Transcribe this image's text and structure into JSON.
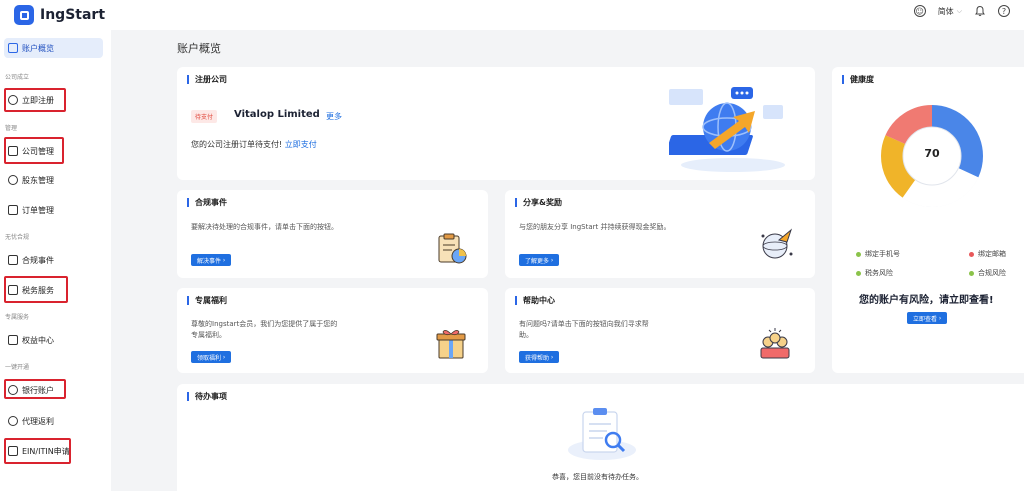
{
  "brand": {
    "name": "IngStart"
  },
  "topbar": {
    "lang": "简体"
  },
  "sidebar": {
    "items": [
      {
        "label": "账户概览"
      },
      {
        "label": "立即注册"
      },
      {
        "label": "公司管理"
      },
      {
        "label": "股东管理"
      },
      {
        "label": "订单管理"
      },
      {
        "label": "合规事件"
      },
      {
        "label": "税务服务"
      },
      {
        "label": "权益中心"
      },
      {
        "label": "银行账户"
      },
      {
        "label": "代理返利"
      },
      {
        "label": "EIN/ITIN申请"
      }
    ],
    "sections": [
      "公司成立",
      "管理",
      "无忧合规",
      "专属服务",
      "一键开通"
    ]
  },
  "main": {
    "title": "账户概览",
    "register_card": {
      "title": "注册公司",
      "status_tag": "待支付",
      "company_name": "Vitalop Limited",
      "more_link": "更多",
      "pay_message": "您的公司注册订单待支付!",
      "pay_link": "立即支付"
    },
    "compliance": {
      "title": "合规事件",
      "desc": "要解决待处理的合规事件，请单击下面的按钮。",
      "button": "解决事件"
    },
    "share": {
      "title": "分享&奖励",
      "desc": "与您的朋友分享 IngStart 并持续获得现金奖励。",
      "button": "了解更多"
    },
    "benefits": {
      "title": "专属福利",
      "desc": "尊敬的Ingstart会员，我们为您提供了属于您的专属福利。",
      "button": "领取福利"
    },
    "help": {
      "title": "帮助中心",
      "desc": "有问题吗?请单击下面的按钮向我们寻求帮助。",
      "button": "获得帮助"
    },
    "health": {
      "title": "健康度",
      "score": "70",
      "legend": [
        {
          "label": "绑定手机号",
          "color": "#8bc34a"
        },
        {
          "label": "绑定邮箱",
          "color": "#e8585a"
        },
        {
          "label": "税务风险",
          "color": "#8bc34a"
        },
        {
          "label": "合规风险",
          "color": "#8bc34a"
        }
      ],
      "warning": "您的账户有风险，请立即查看!",
      "button": "立即查看"
    },
    "todo": {
      "title": "待办事项",
      "empty_message": "恭喜，您目前没有待办任务。"
    }
  }
}
